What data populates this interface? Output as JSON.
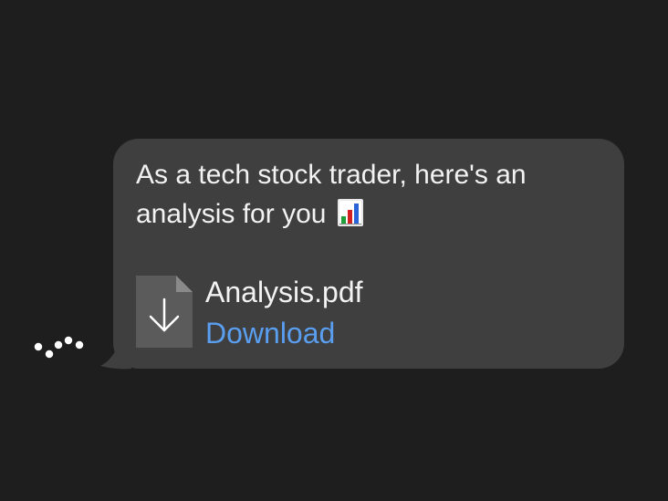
{
  "message": {
    "text_before_emoji": "As a tech stock trader, here's an analysis for you",
    "emoji_icon": "bar-chart-emoji-icon"
  },
  "attachment": {
    "file_name": "Analysis.pdf",
    "download_label": "Download",
    "icon": "file-download-icon"
  },
  "colors": {
    "background": "#1e1e1e",
    "bubble": "#3f3f3f",
    "text": "#f2f2f2",
    "link": "#5a9ef0"
  }
}
